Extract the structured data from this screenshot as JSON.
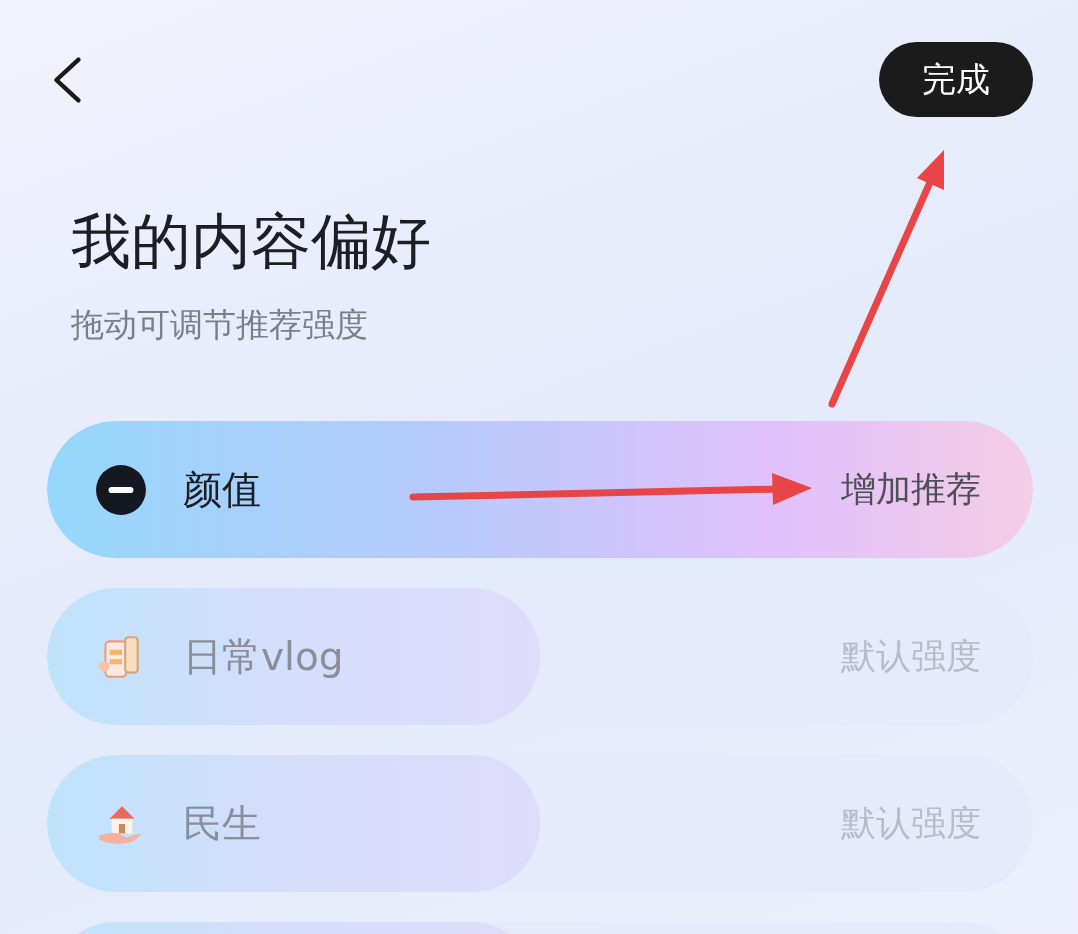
{
  "header": {
    "done_button": "完成"
  },
  "title": "我的内容偏好",
  "subtitle": "拖动可调节推荐强度",
  "preferences": [
    {
      "kind": "remove",
      "label": "颜值",
      "reading": "增加推荐",
      "level": 1,
      "selected": true
    },
    {
      "kind": "vlog",
      "label": "日常vlog",
      "reading": "默认强度",
      "level": 0.5,
      "selected": false
    },
    {
      "kind": "livelihood",
      "label": "民生",
      "reading": "默认强度",
      "level": 0.5,
      "selected": false
    }
  ],
  "partially_visible_slider": {
    "level": 0.5
  }
}
